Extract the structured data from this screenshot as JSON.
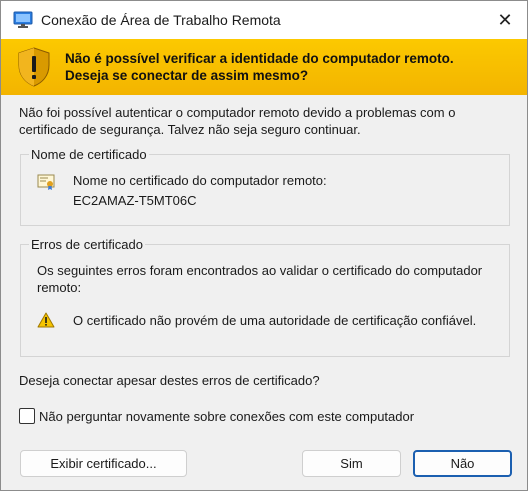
{
  "window": {
    "title": "Conexão de Área de Trabalho Remota",
    "close_glyph": "✕"
  },
  "banner": {
    "line1": "Não é possível verificar a identidade do computador remoto.",
    "line2": "Deseja se conectar de assim mesmo?"
  },
  "intro": "Não foi possível autenticar o computador remoto devido a problemas com o certificado de segurança. Talvez não seja seguro continuar.",
  "cert_name_group": {
    "legend": "Nome de certificado",
    "label": "Nome no certificado do computador remoto:",
    "value": "EC2AMAZ-T5MT06C"
  },
  "cert_errors_group": {
    "legend": "Erros de certificado",
    "description": "Os seguintes erros foram encontrados ao validar o certificado do computador remoto:",
    "error": "O certificado não provém de uma autoridade de certificação confiável."
  },
  "question": "Deseja conectar apesar destes erros de certificado?",
  "checkbox": {
    "label": "Não perguntar novamente sobre conexões com este computador",
    "checked": false
  },
  "buttons": {
    "view_cert": "Exibir certificado...",
    "yes": "Sim",
    "no": "Não"
  },
  "icons": {
    "title": "remote-desktop-icon",
    "banner": "warning-shield-icon",
    "cert": "certificate-icon",
    "warning": "warning-triangle-icon"
  },
  "colors": {
    "banner": "#f6c200",
    "default_button_border": "#1b5fb0"
  }
}
